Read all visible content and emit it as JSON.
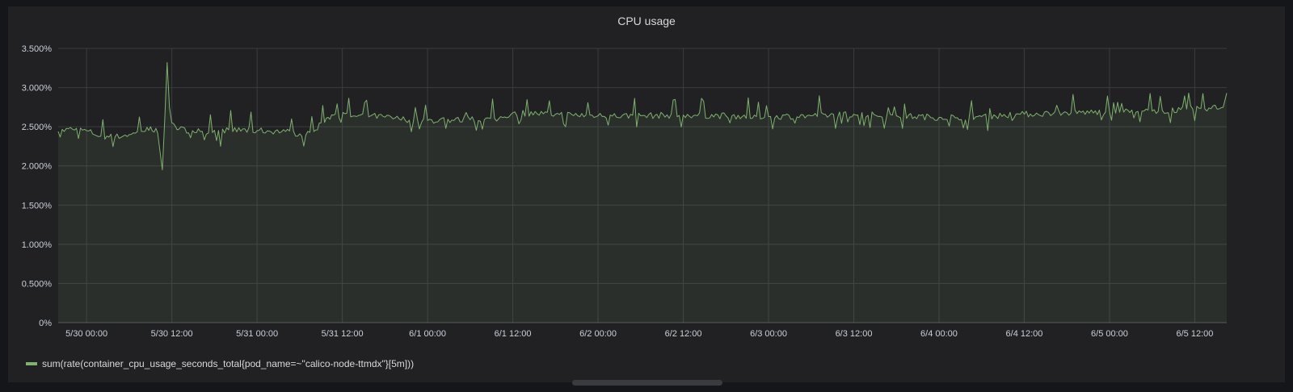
{
  "panel": {
    "title": "CPU usage"
  },
  "chart_data": {
    "type": "area",
    "title": "CPU usage",
    "xlabel": "",
    "ylabel": "",
    "x_range": [
      "2019-05-29 20:00",
      "2019-06-05 16:30"
    ],
    "ylim": [
      0,
      3.5
    ],
    "y_unit": "%",
    "y_ticks": [
      0,
      0.5,
      1.0,
      1.5,
      2.0,
      2.5,
      3.0,
      3.5
    ],
    "y_tick_labels": [
      "0%",
      "0.500%",
      "1.000%",
      "1.500%",
      "2.000%",
      "2.500%",
      "3.000%",
      "3.500%"
    ],
    "x_ticks": [
      "2019-05-30 00:00",
      "2019-05-30 12:00",
      "2019-05-31 00:00",
      "2019-05-31 12:00",
      "2019-06-01 00:00",
      "2019-06-01 12:00",
      "2019-06-02 00:00",
      "2019-06-02 12:00",
      "2019-06-03 00:00",
      "2019-06-03 12:00",
      "2019-06-04 00:00",
      "2019-06-04 12:00",
      "2019-06-05 00:00",
      "2019-06-05 12:00"
    ],
    "x_tick_labels": [
      "5/30 00:00",
      "5/30 12:00",
      "5/31 00:00",
      "5/31 12:00",
      "6/1 00:00",
      "6/1 12:00",
      "6/2 00:00",
      "6/2 12:00",
      "6/3 00:00",
      "6/3 12:00",
      "6/4 00:00",
      "6/4 12:00",
      "6/5 00:00",
      "6/5 12:00"
    ],
    "grid": true,
    "legend_position": "bottom-left",
    "series": [
      {
        "name": "sum(rate(container_cpu_usage_seconds_total{pod_name=~\"calico-node-ttmdx\"}[5m]))",
        "color": "#7eb26d",
        "points": [
          [
            "2019-05-29 20:00",
            2.44
          ],
          [
            "2019-05-29 22:00",
            2.47
          ],
          [
            "2019-05-30 00:00",
            2.45
          ],
          [
            "2019-05-30 02:00",
            2.38
          ],
          [
            "2019-05-30 04:00",
            2.37
          ],
          [
            "2019-05-30 06:00",
            2.4
          ],
          [
            "2019-05-30 08:00",
            2.44
          ],
          [
            "2019-05-30 09:00",
            2.5
          ],
          [
            "2019-05-30 10:00",
            2.42
          ],
          [
            "2019-05-30 10:40",
            1.95
          ],
          [
            "2019-05-30 11:00",
            2.6
          ],
          [
            "2019-05-30 11:20",
            3.32
          ],
          [
            "2019-05-30 11:40",
            2.75
          ],
          [
            "2019-05-30 12:00",
            2.55
          ],
          [
            "2019-05-30 13:00",
            2.47
          ],
          [
            "2019-05-30 16:00",
            2.44
          ],
          [
            "2019-05-30 20:00",
            2.46
          ],
          [
            "2019-05-31 00:00",
            2.45
          ],
          [
            "2019-05-31 04:00",
            2.44
          ],
          [
            "2019-05-31 06:00",
            2.41
          ],
          [
            "2019-05-31 08:00",
            2.44
          ],
          [
            "2019-05-31 09:00",
            2.55
          ],
          [
            "2019-05-31 10:00",
            2.62
          ],
          [
            "2019-05-31 11:00",
            2.66
          ],
          [
            "2019-05-31 14:00",
            2.63
          ],
          [
            "2019-05-31 16:00",
            2.64
          ],
          [
            "2019-05-31 20:00",
            2.6
          ],
          [
            "2019-06-01 00:00",
            2.58
          ],
          [
            "2019-06-01 06:00",
            2.59
          ],
          [
            "2019-06-01 10:00",
            2.6
          ],
          [
            "2019-06-01 12:00",
            2.68
          ],
          [
            "2019-06-01 18:00",
            2.66
          ],
          [
            "2019-06-02 00:00",
            2.64
          ],
          [
            "2019-06-02 06:00",
            2.64
          ],
          [
            "2019-06-02 12:00",
            2.65
          ],
          [
            "2019-06-02 18:00",
            2.64
          ],
          [
            "2019-06-03 00:00",
            2.63
          ],
          [
            "2019-06-03 06:00",
            2.64
          ],
          [
            "2019-06-03 12:00",
            2.66
          ],
          [
            "2019-06-03 18:00",
            2.64
          ],
          [
            "2019-06-04 00:00",
            2.62
          ],
          [
            "2019-06-04 06:00",
            2.63
          ],
          [
            "2019-06-04 12:00",
            2.66
          ],
          [
            "2019-06-04 18:00",
            2.68
          ],
          [
            "2019-06-05 00:00",
            2.69
          ],
          [
            "2019-06-05 06:00",
            2.7
          ],
          [
            "2019-06-05 10:00",
            2.72
          ],
          [
            "2019-06-05 14:00",
            2.74
          ],
          [
            "2019-06-05 16:00",
            2.75
          ],
          [
            "2019-06-05 16:30",
            2.93
          ]
        ]
      }
    ]
  }
}
